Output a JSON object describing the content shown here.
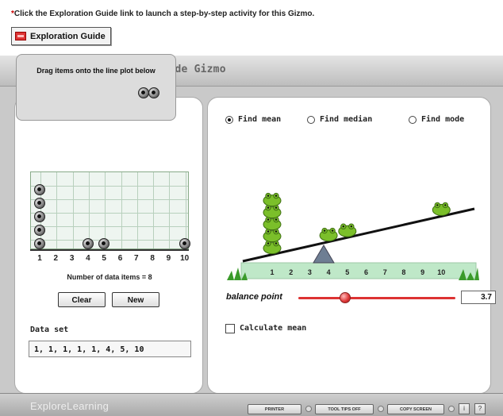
{
  "instructions": {
    "asterisk": "*",
    "text": "Click the Exploration Guide link to launch a step-by-step activity for this Gizmo."
  },
  "exploration_guide": {
    "label": "Exploration Guide",
    "icon": "book-icon"
  },
  "title": "Mean, Median and Mode Gizmo",
  "left_panel": {
    "drag_hint": "Drag items onto the line plot below",
    "line_plot": {
      "x_ticks": [
        "1",
        "2",
        "3",
        "4",
        "5",
        "6",
        "7",
        "8",
        "9",
        "10"
      ],
      "items": [
        {
          "value": 1,
          "stack": 1
        },
        {
          "value": 1,
          "stack": 2
        },
        {
          "value": 1,
          "stack": 3
        },
        {
          "value": 1,
          "stack": 4
        },
        {
          "value": 1,
          "stack": 5
        },
        {
          "value": 4,
          "stack": 1
        },
        {
          "value": 5,
          "stack": 1
        },
        {
          "value": 10,
          "stack": 1
        }
      ]
    },
    "count_text": "Number of data items = 8",
    "clear_label": "Clear",
    "new_label": "New",
    "dataset_label": "Data set",
    "dataset_value": "1, 1, 1, 1, 1, 4, 5, 10"
  },
  "right_panel": {
    "options": [
      {
        "label": "Find mean",
        "selected": true
      },
      {
        "label": "Find median",
        "selected": false
      },
      {
        "label": "Find mode",
        "selected": false
      }
    ],
    "number_line": [
      "1",
      "2",
      "3",
      "4",
      "5",
      "6",
      "7",
      "8",
      "9",
      "10"
    ],
    "frogs": [
      {
        "value": 1,
        "count": 5
      },
      {
        "value": 4,
        "count": 1
      },
      {
        "value": 5,
        "count": 1
      },
      {
        "value": 10,
        "count": 1
      }
    ],
    "balance_label": "balance point",
    "balance_value": "3.7",
    "balance_fraction": 0.3,
    "calc_label": "Calculate mean"
  },
  "footer": {
    "logo": "ExploreLearning",
    "buttons": [
      "PRINTER",
      "TOOL TIPS OFF",
      "COPY SCREEN"
    ]
  },
  "colors": {
    "frog": "#7bbf2a",
    "slider": "#dd3333",
    "ground": "#bfe8c8"
  }
}
